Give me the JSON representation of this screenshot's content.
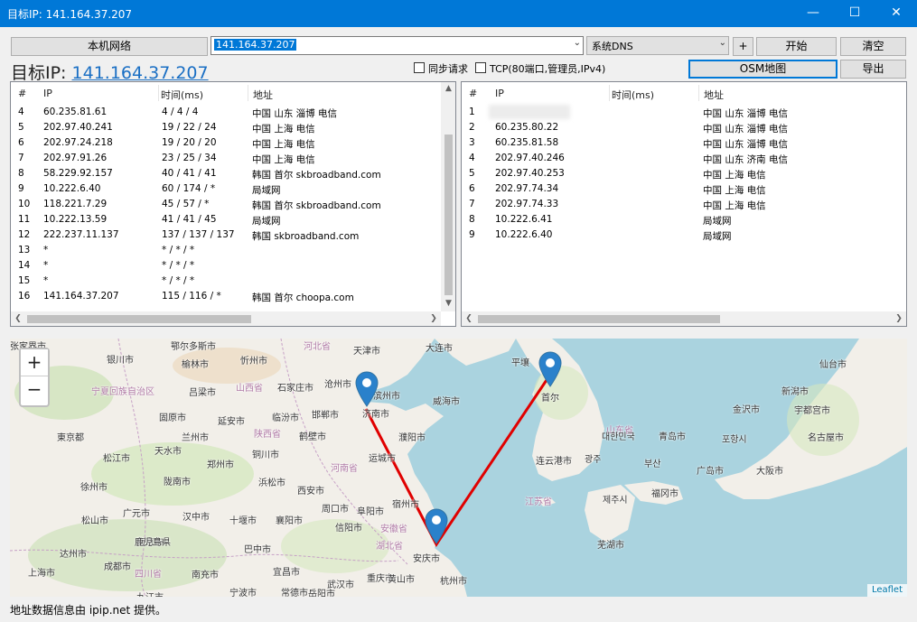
{
  "window": {
    "title": "目标IP: 141.164.37.207",
    "min_icon": "minimize-icon",
    "max_icon": "maximize-icon",
    "close_icon": "close-icon"
  },
  "toolbar": {
    "local_network": "本机网络",
    "target_input": "141.164.37.207",
    "dns_select": "系统DNS",
    "add_label": "+",
    "start_label": "开始",
    "clear_label": "清空",
    "osm_label": "OSM地图",
    "export_label": "导出"
  },
  "target": {
    "label": "目标IP: ",
    "ip": "141.164.37.207"
  },
  "options": {
    "sync_label": "同步请求",
    "tcp_label": "TCP(80端口,管理员,IPv4)"
  },
  "left_list": {
    "headers": {
      "num": "#",
      "ip": "IP",
      "time": "时间(ms)",
      "addr": "地址"
    },
    "rows": [
      {
        "num": "4",
        "ip": "60.235.81.61",
        "time": "4 / 4 / 4",
        "addr": "中国 山东 淄博 电信"
      },
      {
        "num": "5",
        "ip": "202.97.40.241",
        "time": "19 / 22 / 24",
        "addr": "中国 上海 电信"
      },
      {
        "num": "6",
        "ip": "202.97.24.218",
        "time": "19 / 20 / 20",
        "addr": "中国 上海 电信"
      },
      {
        "num": "7",
        "ip": "202.97.91.26",
        "time": "23 / 25 / 34",
        "addr": "中国 上海 电信"
      },
      {
        "num": "8",
        "ip": "58.229.92.157",
        "time": "40 / 41 / 41",
        "addr": "韩国 首尔 skbroadband.com"
      },
      {
        "num": "9",
        "ip": "10.222.6.40",
        "time": "60 / 174 / *",
        "addr": "局域网"
      },
      {
        "num": "10",
        "ip": "118.221.7.29",
        "time": "45 / 57 / *",
        "addr": "韩国 首尔 skbroadband.com"
      },
      {
        "num": "11",
        "ip": "10.222.13.59",
        "time": "41 / 41 / 45",
        "addr": "局域网"
      },
      {
        "num": "12",
        "ip": "222.237.11.137",
        "time": "137 / 137 / 137",
        "addr": "韩国 skbroadband.com"
      },
      {
        "num": "13",
        "ip": "*",
        "time": "* / * / *",
        "addr": ""
      },
      {
        "num": "14",
        "ip": "*",
        "time": "* / * / *",
        "addr": ""
      },
      {
        "num": "15",
        "ip": "*",
        "time": "* / * / *",
        "addr": ""
      },
      {
        "num": "16",
        "ip": "141.164.37.207",
        "time": "115 / 116 / *",
        "addr": "韩国 首尔 choopa.com"
      }
    ]
  },
  "right_list": {
    "headers": {
      "num": "#",
      "ip": "IP",
      "time": "时间(ms)",
      "addr": "地址"
    },
    "rows": [
      {
        "num": "1",
        "ip": "",
        "time": "",
        "addr": "中国 山东 淄博 电信"
      },
      {
        "num": "2",
        "ip": "60.235.80.22",
        "time": "",
        "addr": "中国 山东 淄博 电信"
      },
      {
        "num": "3",
        "ip": "60.235.81.58",
        "time": "",
        "addr": "中国 山东 淄博 电信"
      },
      {
        "num": "4",
        "ip": "202.97.40.246",
        "time": "",
        "addr": "中国 山东 济南 电信"
      },
      {
        "num": "5",
        "ip": "202.97.40.253",
        "time": "",
        "addr": "中国 上海 电信"
      },
      {
        "num": "6",
        "ip": "202.97.74.34",
        "time": "",
        "addr": "中国 上海 电信"
      },
      {
        "num": "7",
        "ip": "202.97.74.33",
        "time": "",
        "addr": "中国 上海 电信"
      },
      {
        "num": "8",
        "ip": "10.222.6.41",
        "time": "",
        "addr": "局域网"
      },
      {
        "num": "9",
        "ip": "10.222.6.40",
        "time": "",
        "addr": "局域网"
      }
    ]
  },
  "map": {
    "zoom_in": "+",
    "zoom_out": "−",
    "attribution": "Leaflet",
    "labels": [
      "鄂尔多斯市",
      "河北省",
      "天津市",
      "大连市",
      "平壤",
      "银川市",
      "榆林市",
      "忻州市",
      "沧州市",
      "首尔",
      "仙台市",
      "宁夏回族自治区",
      "吕梁市",
      "山西省",
      "石家庄市",
      "滨州市",
      "威海市",
      "金沢市",
      "新潟市",
      "宇都宫市",
      "固原市",
      "延安市",
      "临汾市",
      "邯郸市",
      "济南市",
      "山东省",
      "대한민국",
      "포항시",
      "名古屋市",
      "東京都",
      "兰州市",
      "陕西省",
      "鹤壁市",
      "濮阳市",
      "青岛市",
      "松江市",
      "天水市",
      "铜川市",
      "郑州市",
      "运城市",
      "连云港市",
      "광주",
      "부산",
      "广岛市",
      "大阪市",
      "浜松市",
      "河南省",
      "徐州市",
      "陇南市",
      "西安市",
      "周口市",
      "阜阳市",
      "宿州市",
      "江苏省",
      "제주시",
      "福冈市",
      "松山市",
      "广元市",
      "汉中市",
      "十堰市",
      "襄阳市",
      "信阳市",
      "安徽省",
      "南京市",
      "巴中市",
      "湖北省",
      "芜湖市",
      "鹿児島県",
      "达州市",
      "成都市",
      "南充市",
      "宜昌市",
      "武汉市",
      "安庆市",
      "上海市",
      "四川省",
      "重庆市",
      "黄山市",
      "杭州市",
      "宁波市",
      "常德市",
      "岳阳市",
      "九江市",
      "张家界市"
    ],
    "route_color": "#e00000",
    "marker_color": "#2a81cb"
  },
  "status": "地址数据信息由 ipip.net 提供。"
}
